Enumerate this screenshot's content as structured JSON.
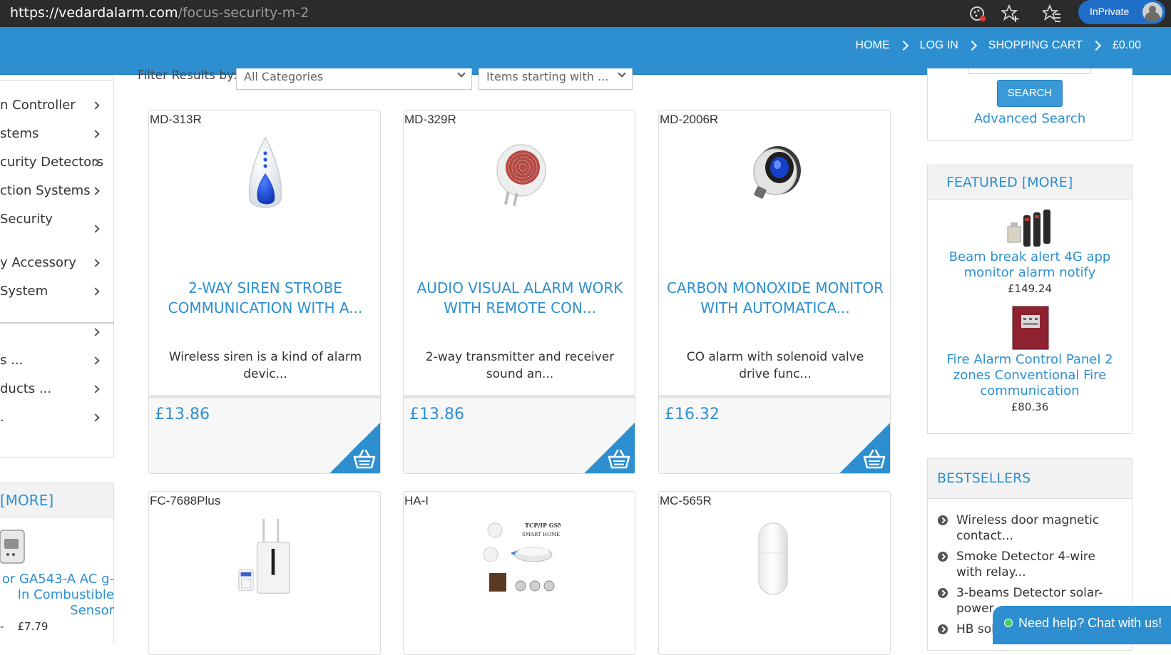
{
  "browser": {
    "url_host": "https://vedardalarm.com",
    "url_path": "/focus-security-m-2",
    "inprivate_label": "InPrivate"
  },
  "nav": {
    "home": "HOME",
    "login": "LOG IN",
    "cart": "SHOPPING CART",
    "total": "£0.00"
  },
  "filter": {
    "label": "Filter Results by:",
    "category": "All Categories",
    "starting": "Items starting with ..."
  },
  "left_categories": [
    "n Controller",
    "stems",
    "curity Detectors",
    "ction Systems",
    "Security",
    "y Accessory",
    "System",
    "",
    "s ...",
    "ducts ...",
    "."
  ],
  "left_featured": {
    "more": "[MORE]",
    "name": "or GA543-A AC g-In Combustible Sensor",
    "price_prefix": "-",
    "price": "£7.79"
  },
  "products": [
    {
      "model": "MD-313R",
      "title": "2-WAY SIREN STROBE COMMUNICATION WITH A...",
      "desc": "Wireless siren is a kind of alarm devic...",
      "price": "£13.86"
    },
    {
      "model": "MD-329R",
      "title": "AUDIO VISUAL ALARM WORK WITH REMOTE CON...",
      "desc": "2-way transmitter and receiver sound an...",
      "price": "£13.86"
    },
    {
      "model": "MD-2006R",
      "title": "CARBON MONOXIDE MONITOR WITH AUTOMATICA...",
      "desc": "CO alarm with solenoid valve drive func...",
      "price": "£16.32"
    },
    {
      "model": "FC-7688Plus"
    },
    {
      "model": "HA-I",
      "img_text_1": "TCP/IP GSM",
      "img_text_2": "SMART HOME"
    },
    {
      "model": "MC-565R"
    }
  ],
  "search": {
    "button": "SEARCH",
    "advanced": "Advanced Search"
  },
  "featured": {
    "header": "FEATURED  [MORE]",
    "items": [
      {
        "name": "Beam break alert 4G app monitor alarm notify",
        "price": "£149.24"
      },
      {
        "name": "Fire Alarm Control Panel 2 zones Conventional Fire communication",
        "price": "£80.36"
      }
    ]
  },
  "bestsellers": {
    "header": "BESTSELLERS",
    "items": [
      "Wireless door magnetic contact...",
      "Smoke Detector 4-wire with relay...",
      "3-beams Detector solar-power...",
      "HB sol..."
    ]
  },
  "chat": {
    "label": "Need help? Chat with us!"
  },
  "colors": {
    "accent": "#2d8fd0",
    "browser_bar": "#2b2b2b"
  }
}
